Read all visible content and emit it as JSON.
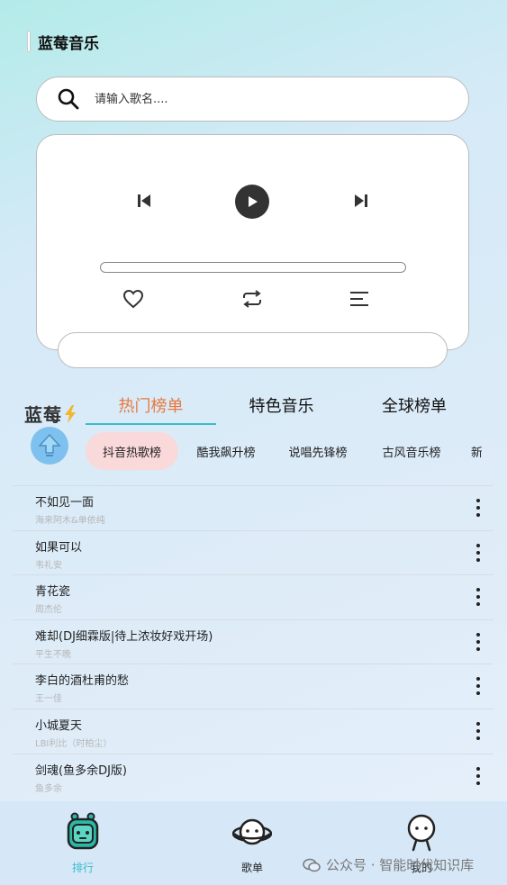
{
  "app": {
    "title": "蓝莓音乐"
  },
  "search": {
    "placeholder": "请输入歌名...."
  },
  "player": {
    "progress_fraction": 0
  },
  "brand": {
    "text": "蓝莓"
  },
  "tabs": [
    {
      "label": "热门榜单",
      "active": true
    },
    {
      "label": "特色音乐",
      "active": false
    },
    {
      "label": "全球榜单",
      "active": false
    }
  ],
  "chips": [
    {
      "label": "抖音热歌榜",
      "active": true
    },
    {
      "label": "酷我飙升榜",
      "active": false
    },
    {
      "label": "说唱先锋榜",
      "active": false
    },
    {
      "label": "古风音乐榜",
      "active": false
    },
    {
      "label": "新",
      "active": false
    }
  ],
  "songs": [
    {
      "title": "不如见一面",
      "artist": "海来阿木&单依纯"
    },
    {
      "title": "如果可以",
      "artist": "韦礼安"
    },
    {
      "title": "青花瓷",
      "artist": "周杰伦"
    },
    {
      "title": "难却(DJ细霖版|待上浓妆好戏开场)",
      "artist": "平生不晚"
    },
    {
      "title": "李白的酒杜甫的愁",
      "artist": "王一佳"
    },
    {
      "title": "小城夏天",
      "artist": "LBI利比（时柏尘）"
    },
    {
      "title": "剑魂(鱼多余DJ版)",
      "artist": "鱼多余"
    }
  ],
  "nav": [
    {
      "label": "排行",
      "icon": "robot-icon",
      "active": true
    },
    {
      "label": "歌单",
      "icon": "planet-icon",
      "active": false
    },
    {
      "label": "我的",
      "icon": "person-icon",
      "active": false
    }
  ],
  "watermark": {
    "text": "公众号 · 智能时代知识库",
    "icon": "wechat-icon"
  },
  "colors": {
    "accent_orange": "#e8793d",
    "accent_teal": "#3bbcc9",
    "chip_active_bg": "#fad9db",
    "nav_bg": "#d6e8f8"
  }
}
